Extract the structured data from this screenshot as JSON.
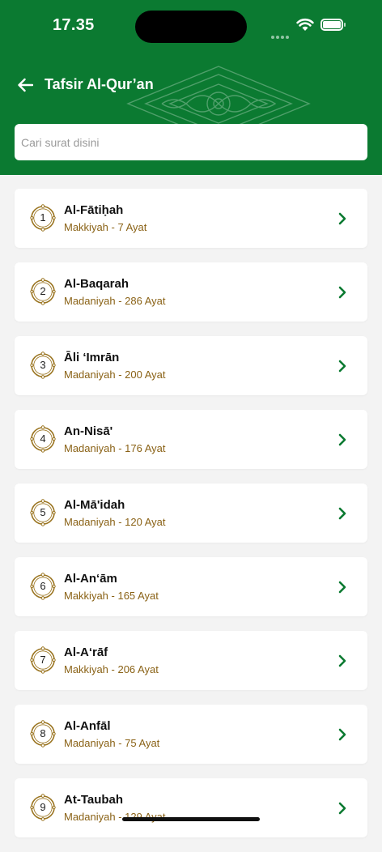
{
  "status_bar": {
    "time": "17.35"
  },
  "header": {
    "title": "Tafsir Al-Qur’an",
    "background_color": "#0b7a31"
  },
  "search": {
    "placeholder": "Cari surat disini",
    "value": ""
  },
  "colors": {
    "accent": "#0b7a31",
    "info_text": "#8a6216",
    "badge_gold": "#9a7420"
  },
  "surahs": [
    {
      "number": "1",
      "name": "Al-Fātiḥah",
      "info": "Makkiyah - 7 Ayat"
    },
    {
      "number": "2",
      "name": "Al-Baqarah",
      "info": "Madaniyah - 286 Ayat"
    },
    {
      "number": "3",
      "name": "Āli ‘Imrān",
      "info": "Madaniyah - 200 Ayat"
    },
    {
      "number": "4",
      "name": "An-Nisā'",
      "info": "Madaniyah - 176 Ayat"
    },
    {
      "number": "5",
      "name": "Al-Mā'idah",
      "info": "Madaniyah - 120 Ayat"
    },
    {
      "number": "6",
      "name": "Al-An‘ām",
      "info": "Makkiyah - 165 Ayat"
    },
    {
      "number": "7",
      "name": "Al-A‘rāf",
      "info": "Makkiyah - 206 Ayat"
    },
    {
      "number": "8",
      "name": "Al-Anfāl",
      "info": "Madaniyah - 75 Ayat"
    },
    {
      "number": "9",
      "name": "At-Taubah",
      "info": "Madaniyah - 129 Ayat"
    }
  ]
}
